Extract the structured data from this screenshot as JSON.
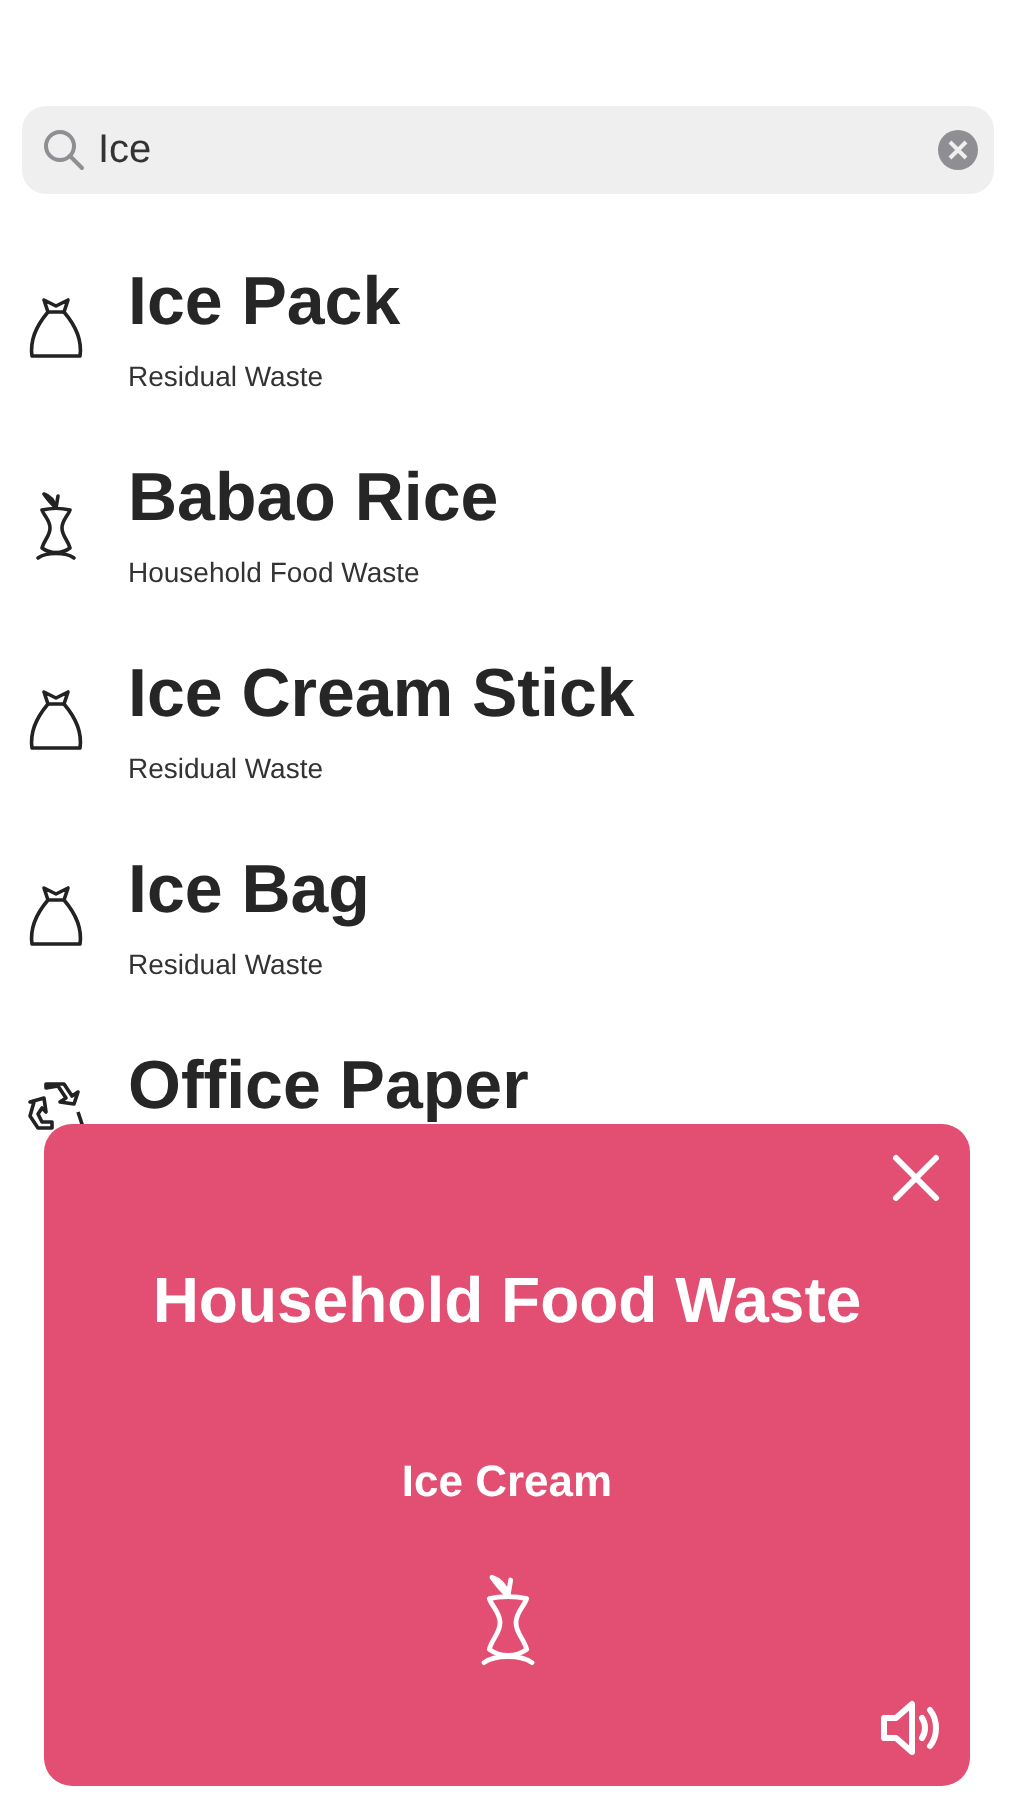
{
  "search": {
    "value": "Ice"
  },
  "results": [
    {
      "title": "Ice Pack",
      "category": "Residual Waste",
      "kind": "residual"
    },
    {
      "title": "Babao Rice",
      "category": "Household Food Waste",
      "kind": "food"
    },
    {
      "title": "Ice Cream Stick",
      "category": "Residual Waste",
      "kind": "residual"
    },
    {
      "title": "Ice Bag",
      "category": "Residual Waste",
      "kind": "residual"
    },
    {
      "title": "Office Paper",
      "kind": "recyclable"
    }
  ],
  "popup": {
    "category": "Household Food Waste",
    "item": "Ice Cream",
    "kind": "food"
  }
}
